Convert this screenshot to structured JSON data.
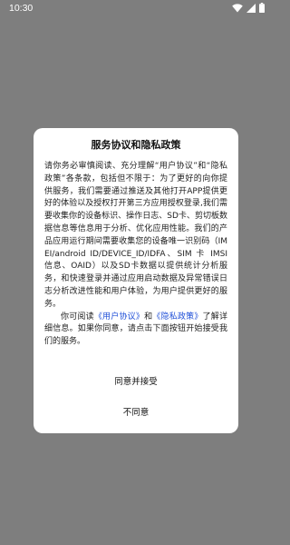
{
  "status_bar": {
    "time": "10:30",
    "icons": [
      "wifi-icon",
      "signal-icon",
      "battery-icon"
    ]
  },
  "dialog": {
    "title": "服务协议和隐私政策",
    "paragraph1": "请你务必审慎阅读、充分理解“用户协议”和“隐私政策”各条款，包括但不限于：为了更好的向你提供服务，我们需要通过推送及其他打开APP提供更好的体验以及授权打开第三方应用授权登录,我们需要收集你的设备标识、操作日志、SD卡、剪切板数据信息等信息用于分析、优化应用性能。我们的产品应用运行期间需要收集您的设备唯一识别码（IMEI/android ID/DEVICE_ID/IDFA、SIM 卡 IMSI 信息、OAID）以及SD卡数据以提供统计分析服务，和快速登录并通过应用启动数据及异常错误日志分析改进性能和用户体验，为用户提供更好的服务。",
    "paragraph2_prefix": "你可阅读",
    "user_agreement_link": "《用户协议》",
    "paragraph2_and": "和",
    "privacy_policy_link": "《隐私政策》",
    "paragraph2_suffix": "了解详细信息。如果你同意，请点击下面按钮开始接受我们的服务。",
    "accept_label": "同意并接受",
    "decline_label": "不同意"
  },
  "colors": {
    "backdrop": "#7e7e7e",
    "dialog_background": "#ffffff",
    "link": "#1f4fd8"
  }
}
